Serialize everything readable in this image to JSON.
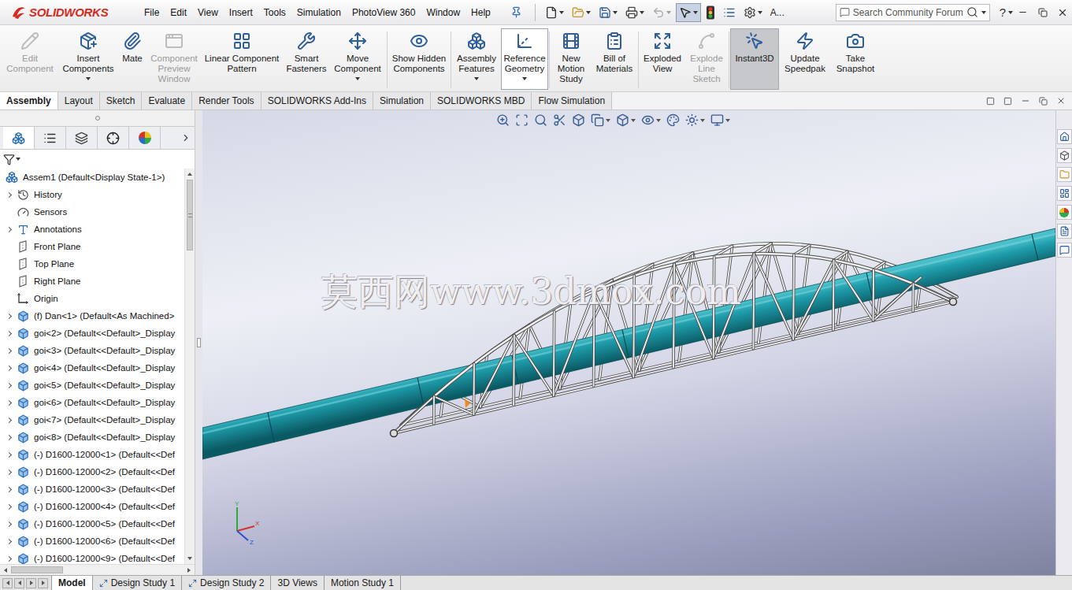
{
  "app": {
    "logo": "SOLIDWORKS"
  },
  "menu": [
    "File",
    "Edit",
    "View",
    "Insert",
    "Tools",
    "Simulation",
    "PhotoView 360",
    "Window",
    "Help"
  ],
  "quick_tools": [
    {
      "dropdown": true,
      "pressed": false,
      "disabled": false
    },
    {
      "dropdown": true,
      "pressed": false,
      "disabled": false
    },
    {
      "dropdown": true,
      "pressed": false,
      "disabled": false
    },
    {
      "dropdown": true,
      "pressed": false,
      "disabled": false
    },
    {
      "dropdown": true,
      "pressed": false,
      "disabled": true
    },
    {
      "dropdown": true,
      "pressed": true,
      "disabled": false
    },
    {
      "dropdown": false,
      "pressed": false,
      "disabled": false
    },
    {
      "dropdown": false,
      "pressed": false,
      "disabled": false
    },
    {
      "dropdown": true,
      "pressed": false,
      "disabled": false
    }
  ],
  "quick_access": {
    "user": "A...",
    "help": "?"
  },
  "search": {
    "placeholder": "Search Community Forum"
  },
  "ribbon": [
    {
      "label": "Edit Component",
      "disabled": true,
      "dropdown": false,
      "selected": false,
      "hovered": false
    },
    {
      "label": "Insert Components",
      "disabled": false,
      "dropdown": true,
      "selected": false,
      "hovered": false
    },
    {
      "label": "Mate",
      "disabled": false,
      "dropdown": false,
      "selected": false,
      "hovered": false
    },
    {
      "label": "Component Preview Window",
      "disabled": true,
      "dropdown": false,
      "selected": false,
      "hovered": false
    },
    {
      "label": "Linear Component Pattern",
      "disabled": false,
      "dropdown": false,
      "selected": false,
      "hovered": false
    },
    {
      "label": "Smart Fasteners",
      "disabled": false,
      "dropdown": false,
      "selected": false,
      "hovered": false
    },
    {
      "label": "Move Component",
      "disabled": false,
      "dropdown": true,
      "selected": false,
      "hovered": false
    },
    {
      "label": "Show Hidden Components",
      "disabled": false,
      "dropdown": false,
      "selected": false,
      "hovered": false
    },
    {
      "label": "Assembly Features",
      "disabled": false,
      "dropdown": true,
      "selected": false,
      "hovered": false
    },
    {
      "label": "Reference Geometry",
      "disabled": false,
      "dropdown": true,
      "selected": false,
      "hovered": true
    },
    {
      "label": "New Motion Study",
      "disabled": false,
      "dropdown": false,
      "selected": false,
      "hovered": false
    },
    {
      "label": "Bill of Materials",
      "disabled": false,
      "dropdown": false,
      "selected": false,
      "hovered": false
    },
    {
      "label": "Exploded View",
      "disabled": false,
      "dropdown": false,
      "selected": false,
      "hovered": false
    },
    {
      "label": "Explode Line Sketch",
      "disabled": true,
      "dropdown": false,
      "selected": false,
      "hovered": false
    },
    {
      "label": "Instant3D",
      "disabled": false,
      "dropdown": false,
      "selected": true,
      "hovered": false
    },
    {
      "label": "Update Speedpak",
      "disabled": false,
      "dropdown": false,
      "selected": false,
      "hovered": false
    },
    {
      "label": "Take Snapshot",
      "disabled": false,
      "dropdown": false,
      "selected": false,
      "hovered": false
    }
  ],
  "command_tabs": [
    {
      "label": "Assembly",
      "selected": true
    },
    {
      "label": "Layout",
      "selected": false
    },
    {
      "label": "Sketch",
      "selected": false
    },
    {
      "label": "Evaluate",
      "selected": false
    },
    {
      "label": "Render Tools",
      "selected": false
    },
    {
      "label": "SOLIDWORKS Add-Ins",
      "selected": false
    },
    {
      "label": "Simulation",
      "selected": false
    },
    {
      "label": "SOLIDWORKS MBD",
      "selected": false
    },
    {
      "label": "Flow Simulation",
      "selected": false
    }
  ],
  "panel_tabs": [
    {
      "selected": true
    },
    {
      "selected": false
    },
    {
      "selected": false
    },
    {
      "selected": false
    },
    {
      "selected": false
    }
  ],
  "tree": {
    "root": "Assem1  (Default<Display State-1>)",
    "items": [
      {
        "label": "History",
        "kind": "history",
        "expandable": true
      },
      {
        "label": "Sensors",
        "kind": "sensor",
        "expandable": false
      },
      {
        "label": "Annotations",
        "kind": "annotation",
        "expandable": true
      },
      {
        "label": "Front Plane",
        "kind": "plane",
        "expandable": false
      },
      {
        "label": "Top Plane",
        "kind": "plane",
        "expandable": false
      },
      {
        "label": "Right Plane",
        "kind": "plane",
        "expandable": false
      },
      {
        "label": "Origin",
        "kind": "origin",
        "expandable": false
      },
      {
        "label": "(f) Dan<1> (Default<As Machined>",
        "kind": "part",
        "expandable": true
      },
      {
        "label": "goi<2> (Default<<Default>_Display",
        "kind": "part",
        "expandable": true
      },
      {
        "label": "goi<3> (Default<<Default>_Display",
        "kind": "part",
        "expandable": true
      },
      {
        "label": "goi<4> (Default<<Default>_Display",
        "kind": "part",
        "expandable": true
      },
      {
        "label": "goi<5> (Default<<Default>_Display",
        "kind": "part",
        "expandable": true
      },
      {
        "label": "goi<6> (Default<<Default>_Display",
        "kind": "part",
        "expandable": true
      },
      {
        "label": "goi<7> (Default<<Default>_Display",
        "kind": "part",
        "expandable": true
      },
      {
        "label": "goi<8> (Default<<Default>_Display",
        "kind": "part",
        "expandable": true
      },
      {
        "label": "(-) D1600-12000<1> (Default<<Def",
        "kind": "part",
        "expandable": true
      },
      {
        "label": "(-) D1600-12000<2> (Default<<Def",
        "kind": "part",
        "expandable": true
      },
      {
        "label": "(-) D1600-12000<3> (Default<<Def",
        "kind": "part",
        "expandable": true
      },
      {
        "label": "(-) D1600-12000<4> (Default<<Def",
        "kind": "part",
        "expandable": true
      },
      {
        "label": "(-) D1600-12000<5> (Default<<Def",
        "kind": "part",
        "expandable": true
      },
      {
        "label": "(-) D1600-12000<6> (Default<<Def",
        "kind": "part",
        "expandable": true
      },
      {
        "label": "(-) D1600-12000<9> (Default<<Def",
        "kind": "part",
        "expandable": true
      }
    ]
  },
  "scrollbars": {
    "vertical": {
      "level": 0.19
    },
    "horizontal": {
      "level": 0.3
    }
  },
  "heads_up": [
    {
      "dropdown": false
    },
    {
      "dropdown": false
    },
    {
      "dropdown": false
    },
    {
      "dropdown": false
    },
    {
      "dropdown": false
    },
    {
      "dropdown": true
    },
    {
      "dropdown": true
    },
    {
      "dropdown": true
    },
    {
      "dropdown": false
    },
    {
      "dropdown": true
    },
    {
      "dropdown": true
    }
  ],
  "viewport": {
    "watermark": "莫西网www.3dmox.com",
    "triad": {
      "x": "X",
      "y": "Y",
      "z": "Z"
    }
  },
  "bottom_tabs": [
    {
      "label": "Model",
      "selected": true,
      "kind": "plain"
    },
    {
      "label": "Design Study 1",
      "selected": false,
      "kind": "study"
    },
    {
      "label": "Design Study 2",
      "selected": false,
      "kind": "study"
    },
    {
      "label": "3D Views",
      "selected": false,
      "kind": "plain"
    },
    {
      "label": "Motion Study 1",
      "selected": false,
      "kind": "plain"
    }
  ]
}
